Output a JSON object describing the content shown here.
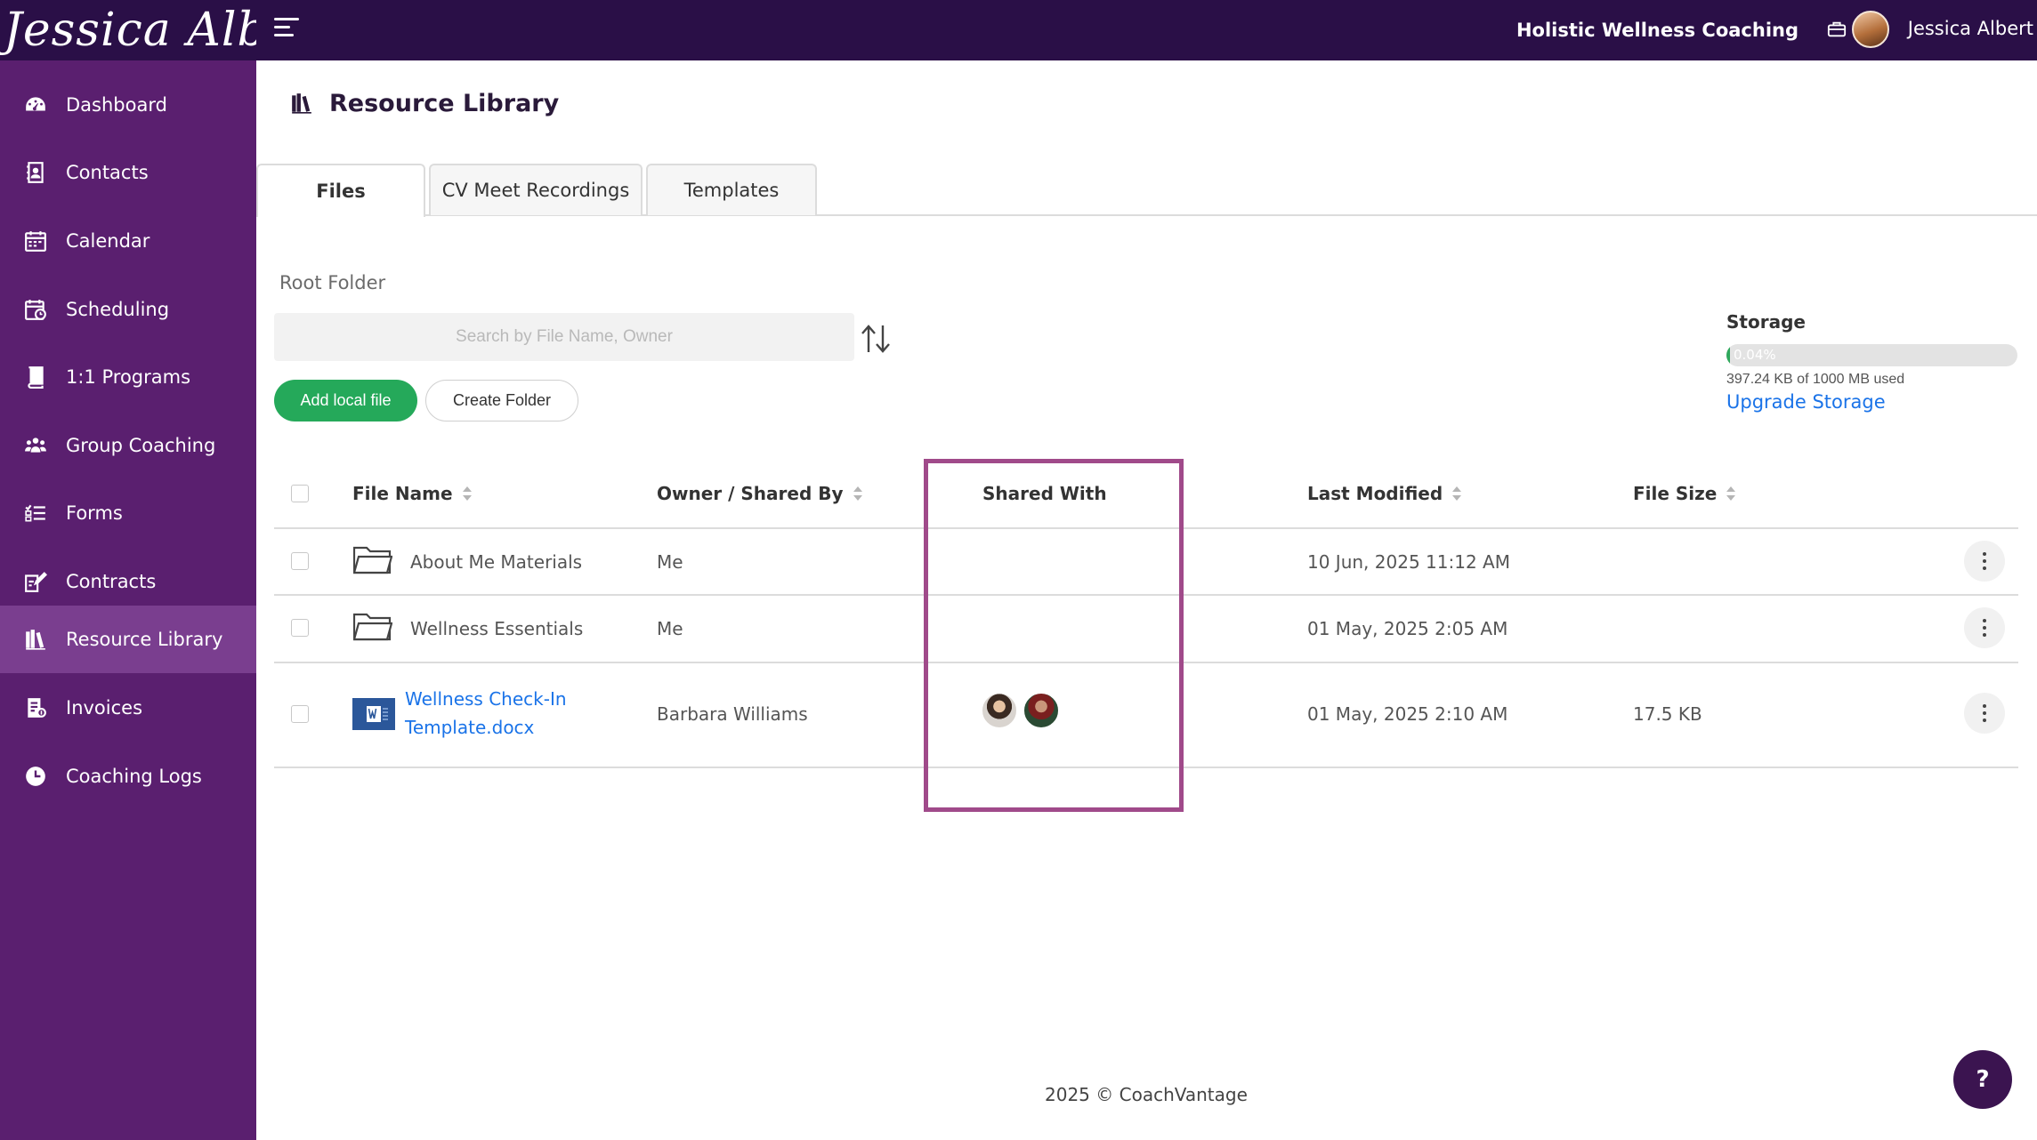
{
  "topbar": {
    "brand": "Jessica Albert",
    "business": "Holistic Wellness Coaching",
    "username": "Jessica Albert"
  },
  "sidebar": {
    "items": [
      {
        "label": "Dashboard",
        "icon": "dashboard-icon"
      },
      {
        "label": "Contacts",
        "icon": "contacts-icon"
      },
      {
        "label": "Calendar",
        "icon": "calendar-icon"
      },
      {
        "label": "Scheduling",
        "icon": "scheduling-icon"
      },
      {
        "label": "1:1 Programs",
        "icon": "programs-icon"
      },
      {
        "label": "Group Coaching",
        "icon": "group-icon"
      },
      {
        "label": "Forms",
        "icon": "forms-icon"
      },
      {
        "label": "Contracts",
        "icon": "contracts-icon"
      },
      {
        "label": "Resource Library",
        "icon": "library-icon",
        "active": true
      },
      {
        "label": "Invoices",
        "icon": "invoices-icon"
      },
      {
        "label": "Coaching Logs",
        "icon": "clock-icon"
      }
    ]
  },
  "page": {
    "title": "Resource Library"
  },
  "tabs": [
    {
      "label": "Files",
      "active": true
    },
    {
      "label": "CV Meet Recordings"
    },
    {
      "label": "Templates"
    }
  ],
  "toolbar": {
    "root_folder": "Root Folder",
    "search_placeholder": "Search by File Name, Owner",
    "add_label": "Add local file",
    "create_folder_label": "Create Folder"
  },
  "storage": {
    "label": "Storage",
    "percent_label": "0.04%",
    "percent": 0.04,
    "used_text": "397.24 KB of 1000 MB used",
    "upgrade_label": "Upgrade Storage"
  },
  "table": {
    "headers": {
      "file_name": "File Name",
      "owner": "Owner / Shared By",
      "shared_with": "Shared With",
      "last_modified": "Last Modified",
      "file_size": "File Size"
    },
    "rows": [
      {
        "name": "About Me Materials",
        "type": "folder",
        "owner": "Me",
        "modified": "10 Jun, 2025 11:12 AM",
        "size": ""
      },
      {
        "name": "Wellness Essentials",
        "type": "folder",
        "owner": "Me",
        "modified": "01 May, 2025 2:05 AM",
        "size": ""
      },
      {
        "name_line1": "Wellness Check-In",
        "name_line2": "Template.docx",
        "type": "docx",
        "owner": "Barbara Williams",
        "modified": "01 May, 2025 2:10 AM",
        "size": "17.5 KB"
      }
    ]
  },
  "footer": {
    "text": "2025 © CoachVantage"
  },
  "help": {
    "label": "?"
  },
  "colors": {
    "topbar": "#2a0f47",
    "sidebar": "#5a1f6f",
    "sidebar_active": "#7a3e8f",
    "primary_green": "#25a95a",
    "link_blue": "#1a73e8",
    "highlight": "#a04a8a"
  }
}
